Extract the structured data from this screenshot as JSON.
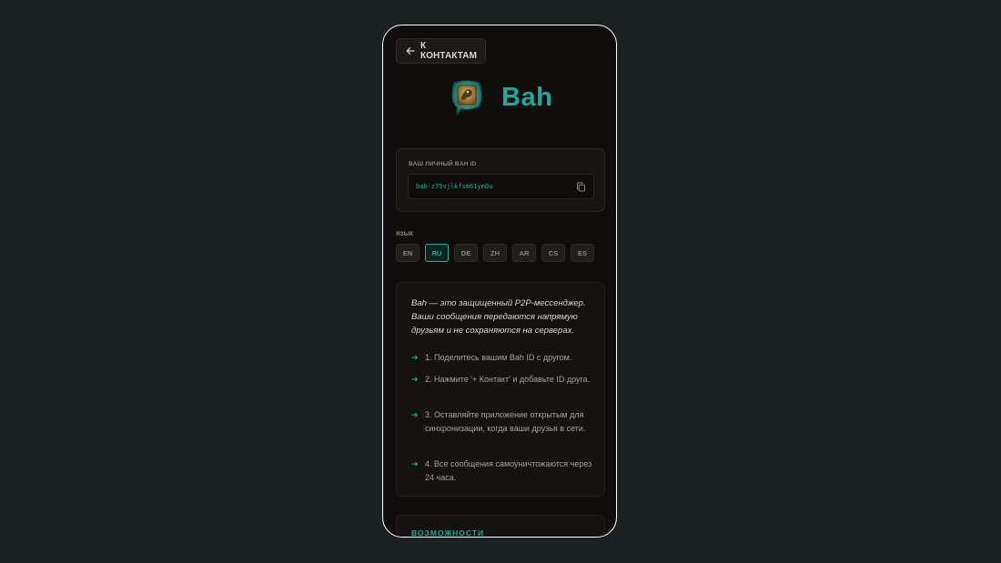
{
  "header": {
    "back_label": "К КОНТАКТАМ"
  },
  "brand": {
    "name": "Bah",
    "accent_color": "#1fa99a"
  },
  "id_card": {
    "label": "ВАШ ЛИЧНЫЙ BAH ID",
    "value": "bah-z79vjlkfsm61ym0u",
    "copy_icon": "copy-icon"
  },
  "language": {
    "label": "ЯЗЫК",
    "options": [
      "EN",
      "RU",
      "DE",
      "ZH",
      "AR",
      "CS",
      "ES"
    ],
    "selected": "RU"
  },
  "info": {
    "intro": "Bah — это защищенный P2P-мессенджер. Ваши сообщения передаются напрямую друзьям и не сохраняются на серверах.",
    "steps": [
      "1. Поделитесь вашим Bah ID с другом.",
      "2. Нажмите '+ Контакт' и добавьте ID друга.",
      "3. Оставляйте приложение открытым для синхронизации, когда ваши друзья в сети.",
      "4. Все сообщения самоуничтожаются через 24 часа."
    ]
  },
  "features": {
    "title": "ВОЗМОЖНОСТИ"
  }
}
